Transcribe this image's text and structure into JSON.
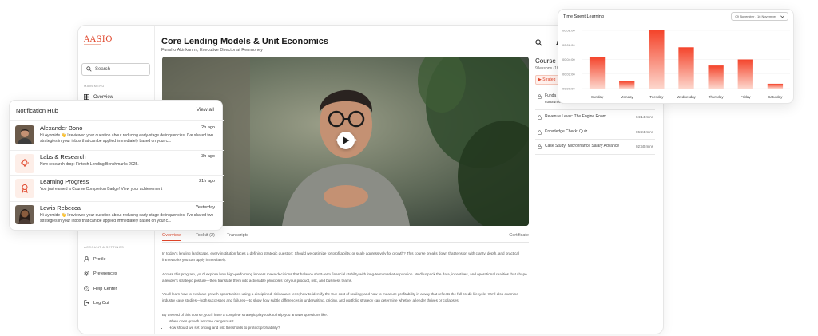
{
  "sidebar": {
    "logo": "AASIO",
    "search_placeholder": "Search",
    "main_menu_label": "MAIN MENU",
    "overview_label": "Overview",
    "account_label": "ACCOUNT & SETTINGS",
    "account_items": [
      "Profile",
      "Preferences",
      "Help Center",
      "Log Out"
    ]
  },
  "course": {
    "title": "Core Lending Models & Unit Economics",
    "instructor": "Funsho Akinkunmi, Executive Director at Renmoney"
  },
  "tabs": [
    "Overview",
    "Toolkit (2)",
    "Transcripts",
    "Certificate"
  ],
  "article": {
    "p1": "In today's lending landscape, every institution faces a defining strategic question: Should we optimize for profitability, or scale aggressively for growth? This course breaks down that tension with clarity, depth, and practical frameworks you can apply immediately.",
    "p2": "Across this program, you'll explore how high-performing lenders make decisions that balance short-term financial stability with long-term market expansion. We'll unpack the data, incentives, and operational realities that shape a lender's strategic posture—then translate them into actionable principles for your product, risk, and business teams.",
    "p3": "You'll learn how to evaluate growth opportunities using a disciplined, risk-aware lens; how to identify the true cost of scaling; and how to measure profitability in a way that reflects the full credit lifecycle. We'll also examine industry case studies—both successes and failures—to show how subtle differences in underwriting, pricing, and portfolio strategy can determine whether a lender thrives or collapses.",
    "p4": "By the end of this course, you'll have a complete strategic playbook to help you answer questions like:",
    "bullet1": "When does growth become dangerous?",
    "bullet2": "How should we set pricing and risk thresholds to protect profitability?"
  },
  "course_panel": {
    "title": "Course C",
    "count": "9 lessons (1h",
    "active_lesson": "Strateg",
    "lessons": [
      {
        "name": "Funda B2B lendingFundamentals of consumer, SME and B2B lending",
        "duration": ""
      },
      {
        "name": "Revenue Lever: The Engine Room",
        "duration": "04:14 mins"
      },
      {
        "name": "Knowledge Check: Quiz",
        "duration": "06:24 mins"
      },
      {
        "name": "Case Study: Microfinance Salary Advance",
        "duration": "02:50 mins"
      }
    ]
  },
  "notifications": {
    "title": "Notification Hub",
    "view_all": "View all",
    "items": [
      {
        "name": "Alexander Bono",
        "time": "2h ago",
        "text": "Hi Ayomide 👋 I reviewed your question about reducing early-stage delinquencies. I've shared two strategies in your inbox that can be applied immediately based on your c...",
        "icon": "avatar-man"
      },
      {
        "name": "Labs & Research",
        "time": "3h ago",
        "text": "New research drop: Fintech Lending Benchmarks 2025.",
        "icon": "lightbulb-icon"
      },
      {
        "name": "Learning Progress",
        "time": "21h ago",
        "text": "You just earned a Course Completion Badge! View your achievement",
        "icon": "badge-icon"
      },
      {
        "name": "Lewis Rebecca",
        "time": "Yesterday",
        "text": "Hi Ayomide 👋 I reviewed your question about reducing early-stage delinquencies. I've shared two strategies in your inbox that can be applied immediately based on your c...",
        "icon": "avatar-woman"
      }
    ]
  },
  "chart_card": {
    "title": "Time Spent Learning",
    "range": "09 November - 16 November"
  },
  "chart_data": {
    "type": "bar",
    "title": "Time Spent Learning",
    "categories": [
      "Sunday",
      "Monday",
      "Tuesday",
      "Wednesday",
      "Thursday",
      "Friday",
      "Saturday"
    ],
    "values": [
      "00:04:20",
      "00:01:00",
      "00:08:00",
      "00:05:40",
      "00:03:10",
      "00:04:00",
      "00:00:40"
    ],
    "values_seconds": [
      260,
      60,
      480,
      340,
      190,
      240,
      40
    ],
    "yticks": [
      "00:00:00",
      "00:02:00",
      "00:04:00",
      "00:06:00",
      "00:08:00"
    ],
    "ylim": [
      0,
      480
    ],
    "colors": {
      "top": "#f4442b",
      "bottom": "#fdd6cc"
    }
  },
  "colors": {
    "accent": "#e0452a"
  }
}
